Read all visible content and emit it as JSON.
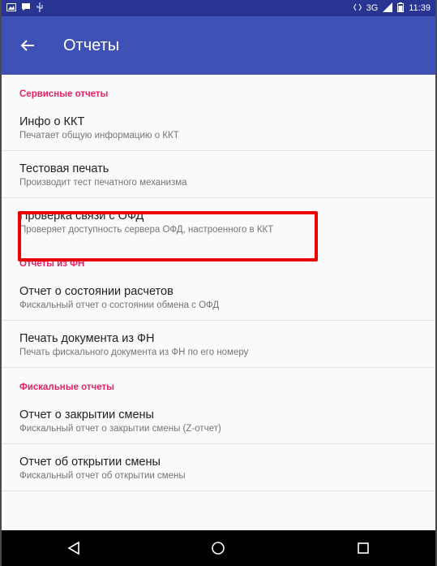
{
  "status_bar": {
    "time": "11:39",
    "network": "3G"
  },
  "app_bar": {
    "title": "Отчеты"
  },
  "sections": [
    {
      "header": "Сервисные отчеты",
      "items": [
        {
          "title": "Инфо о ККТ",
          "subtitle": "Печатает общую информацию о ККТ"
        },
        {
          "title": "Тестовая печать",
          "subtitle": "Производит тест печатного механизма"
        },
        {
          "title": "Проверка связи с ОФД",
          "subtitle": "Проверяет доступность сервера ОФД, настроенного в ККТ"
        }
      ]
    },
    {
      "header": "Отчеты из ФН",
      "items": [
        {
          "title": "Отчет о состоянии расчетов",
          "subtitle": "Фискальный отчет о состоянии обмена с ОФД"
        },
        {
          "title": "Печать документа из ФН",
          "subtitle": "Печать фискального документа из ФН по его номеру"
        }
      ]
    },
    {
      "header": "Фискальные отчеты",
      "items": [
        {
          "title": "Отчет о закрытии смены",
          "subtitle": "Фискальный отчет о закрытии смены (Z-отчет)"
        },
        {
          "title": "Отчет об открытии смены",
          "subtitle": "Фискальный отчет об открытии смены"
        }
      ]
    }
  ],
  "colors": {
    "app_bar": "#3f51b5",
    "status_bar": "#283593",
    "section_header": "#e91e63",
    "highlight": "#ee0000"
  }
}
